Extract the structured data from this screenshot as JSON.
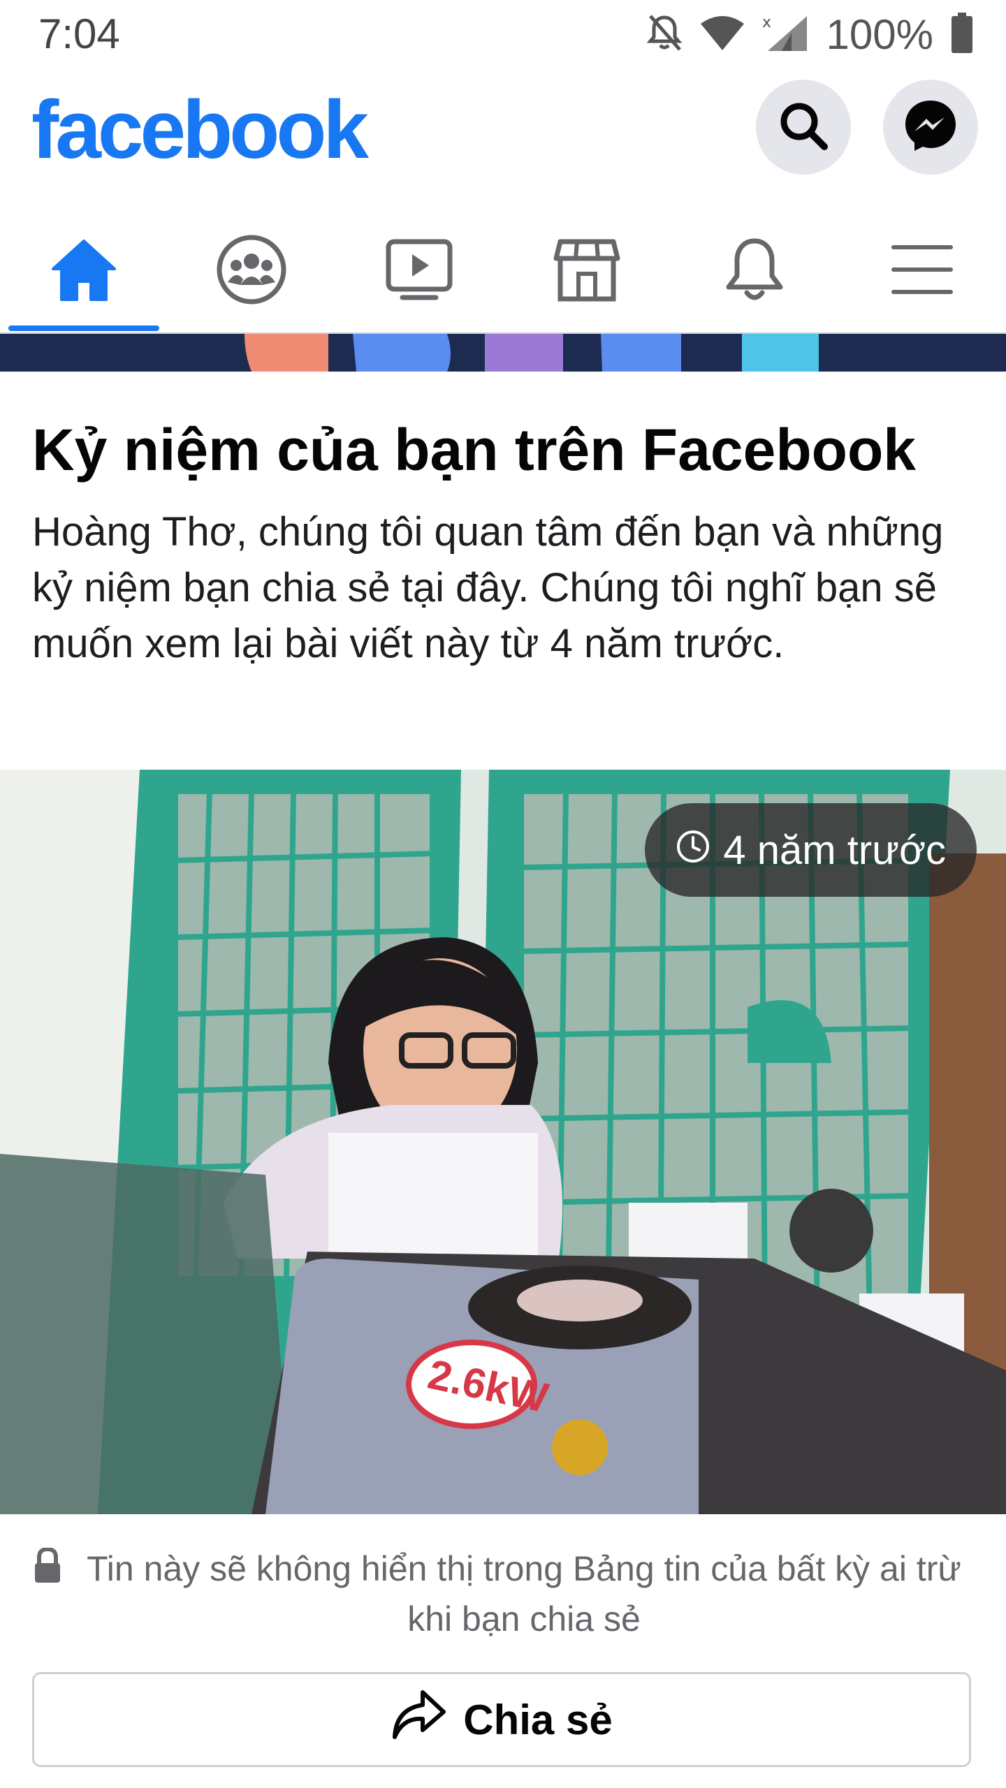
{
  "status_bar": {
    "time": "7:04",
    "battery_text": "100%",
    "icons": [
      "bell-off-icon",
      "wifi-icon",
      "signal-icon",
      "battery-icon"
    ]
  },
  "header": {
    "logo": "facebook",
    "brand_color": "#1877f2",
    "actions": [
      "search-icon",
      "messenger-icon"
    ]
  },
  "tabs": [
    {
      "name": "home-icon",
      "active": true
    },
    {
      "name": "groups-icon",
      "active": false
    },
    {
      "name": "watch-icon",
      "active": false
    },
    {
      "name": "marketplace-icon",
      "active": false
    },
    {
      "name": "notifications-icon",
      "active": false
    },
    {
      "name": "menu-icon",
      "active": false
    }
  ],
  "memory": {
    "title": "Kỷ niệm của bạn trên Facebook",
    "description": "Hoàng Thơ, chúng tôi quan tâm đến bạn và những kỷ niệm bạn chia sẻ tại đây. Chúng tôi nghĩ bạn sẽ muốn xem lại bài viết này từ 4 năm trước.",
    "time_badge": "4 năm trước"
  },
  "privacy_note": "Tin này sẽ không hiển thị trong Bảng tin của bất kỳ ai trừ khi bạn chia sẻ",
  "share_button": {
    "label": "Chia sẻ"
  }
}
